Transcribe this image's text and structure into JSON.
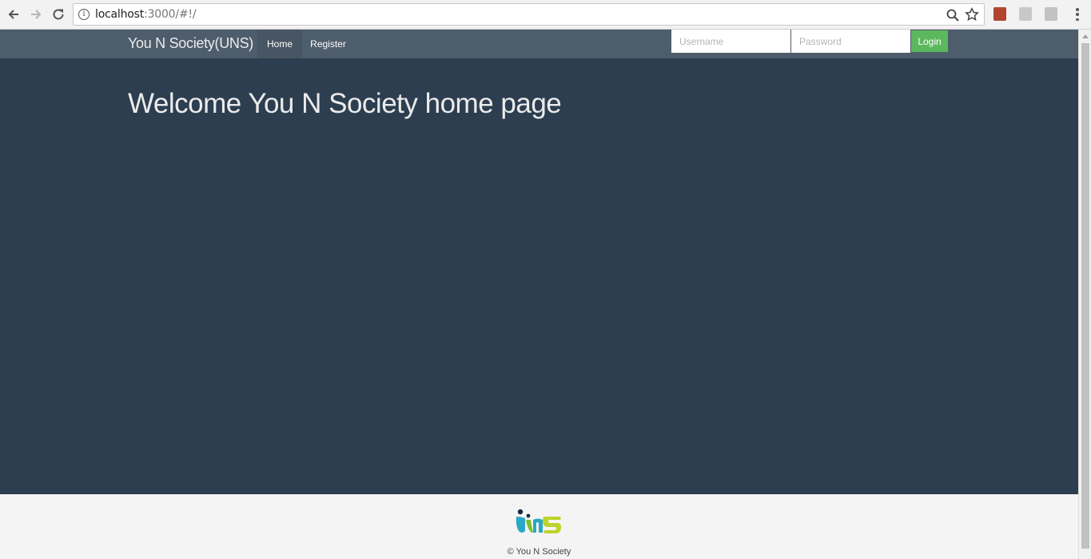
{
  "browser": {
    "url_host": "localhost",
    "url_rest": ":3000/#!/",
    "icons": {
      "back": "arrow-left-icon",
      "forward": "arrow-right-icon",
      "reload": "reload-icon",
      "info": "info-icon",
      "zoom": "magnifier-icon",
      "bookmark": "star-icon",
      "menu": "kebab-menu-icon"
    }
  },
  "navbar": {
    "brand": "You N Society(UNS)",
    "links": [
      {
        "label": "Home",
        "active": true
      },
      {
        "label": "Register",
        "active": false
      }
    ],
    "username_placeholder": "Username",
    "password_placeholder": "Password",
    "login_label": "Login"
  },
  "main": {
    "heading": "Welcome You N Society home page"
  },
  "footer": {
    "logo": "UnS",
    "copyright": "© You N Society"
  },
  "colors": {
    "background": "#2c3e50",
    "navbar": "#4e5d6c",
    "login_button": "#5cb85c",
    "footer": "#f4f4f4"
  }
}
